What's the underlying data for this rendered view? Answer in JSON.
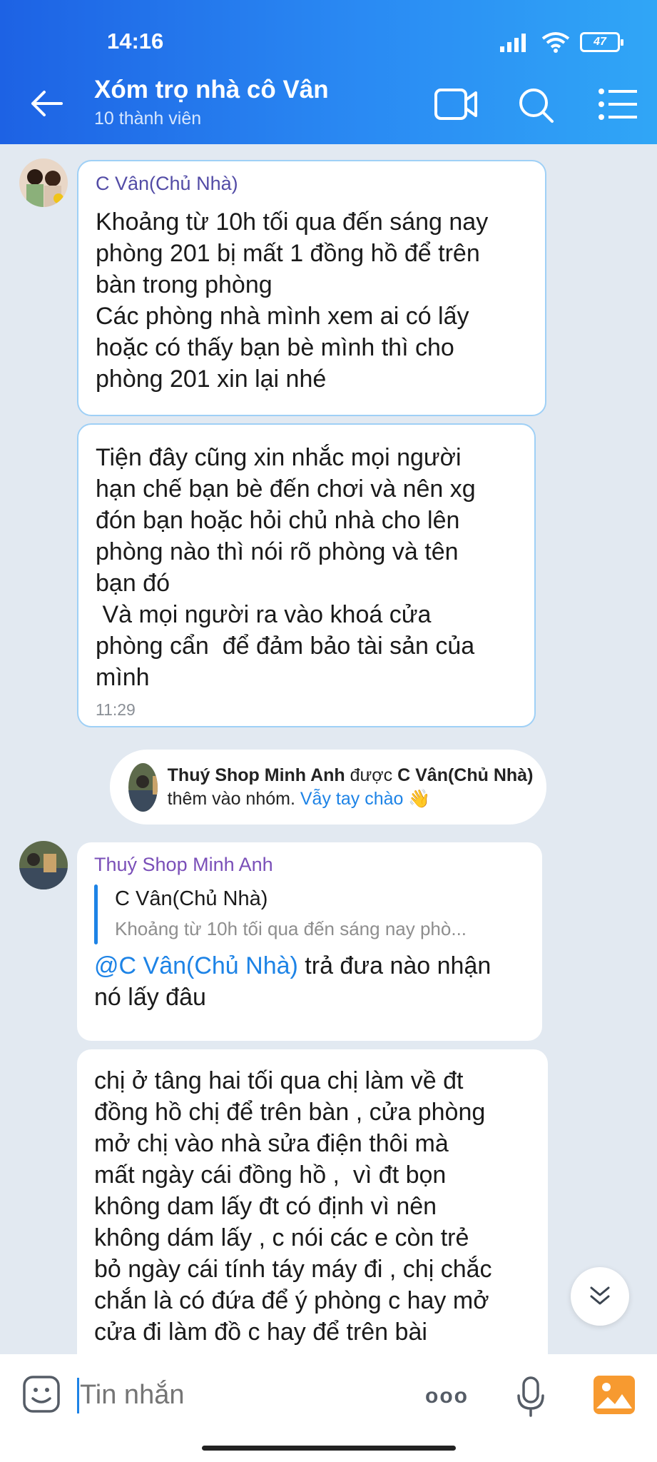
{
  "status": {
    "time": "14:16",
    "battery": "47"
  },
  "header": {
    "title": "Xóm trọ nhà cô Vân",
    "subtitle": "10 thành viên"
  },
  "messages": [
    {
      "sender": "C Vân(Chủ Nhà)",
      "text": "Khoảng từ 10h tối qua đến sáng nay\nphòng 201 bị mất 1 đồng hồ để trên\nbàn trong phòng\nCác phòng nhà mình xem ai có lấy\nhoặc có thấy bạn bè mình thì cho\nphòng 201 xin lại nhé"
    },
    {
      "text": "Tiện đây cũng xin nhắc mọi người\nhạn chế bạn bè đến chơi và nên xg\nđón bạn hoặc hỏi chủ nhà cho lên\nphòng nào thì nói rõ phòng và tên\nbạn đó\n Và mọi người ra vào khoá cửa\nphòng cẩn  để đảm bảo tài sản của\nmình",
      "time": "11:29"
    },
    {
      "sender": "Thuý Shop Minh Anh",
      "quote_name": "C Vân(Chủ Nhà)",
      "quote_text": "Khoảng từ 10h tối qua đến sáng nay phò...",
      "mention": "@C Vân(Chủ Nhà)",
      "text": " trả đưa nào nhận\nnó lấy đâu"
    },
    {
      "text": "chị ở tâng hai tối qua chị làm về đt\nđồng hồ chị để trên bàn , cửa phòng\nmở chị vào nhà sửa điện thôi mà\nmất ngày cái đồng hồ ,  vì đt bọn\nkhông dam lấy đt có định vì nên\nkhông dám lấy , c nói các e còn trẻ\nbỏ ngày cái tính táy máy đi , chị chắc\nchắn là có đứa để ý phòng c hay mở\ncửa đi làm đồ c hay để trên bài"
    }
  ],
  "system": {
    "member": "Thuý Shop Minh Anh",
    "verb": " được ",
    "adder": "C Vân(Chủ Nhà)",
    "suffix": " thêm vào nhóm. ",
    "wave_label": "Vẫy tay chào",
    "wave_emoji": "👋"
  },
  "input": {
    "placeholder": "Tin nhắn",
    "more": "ooo"
  }
}
